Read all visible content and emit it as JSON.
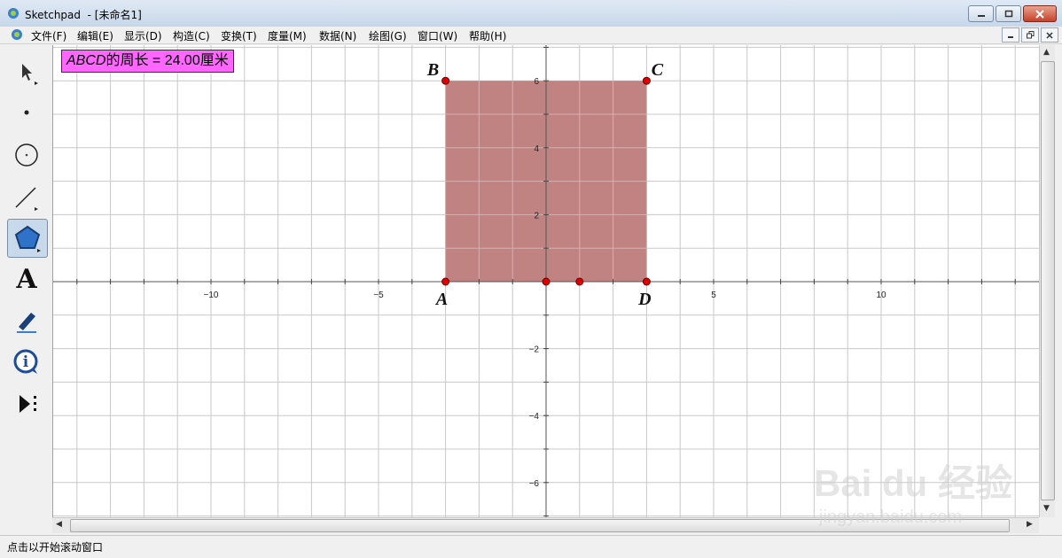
{
  "window": {
    "title": "Sketchpad  - [未命名1]",
    "controls": {
      "minimize": "minimize",
      "restore": "restore",
      "close": "close"
    }
  },
  "menu": [
    {
      "label": "文件(F)"
    },
    {
      "label": "编辑(E)"
    },
    {
      "label": "显示(D)"
    },
    {
      "label": "构造(C)"
    },
    {
      "label": "变换(T)"
    },
    {
      "label": "度量(M)"
    },
    {
      "label": "数据(N)"
    },
    {
      "label": "绘图(G)"
    },
    {
      "label": "窗口(W)"
    },
    {
      "label": "帮助(H)"
    }
  ],
  "toolbox": [
    {
      "name": "arrow-tool",
      "icon": "arrow-select-icon"
    },
    {
      "name": "point-tool",
      "icon": "point-icon"
    },
    {
      "name": "compass-tool",
      "icon": "circle-icon"
    },
    {
      "name": "straightedge-tool",
      "icon": "segment-icon"
    },
    {
      "name": "polygon-tool",
      "icon": "polygon-icon",
      "active": true
    },
    {
      "name": "text-tool",
      "icon": "text-A-icon",
      "glyph": "A"
    },
    {
      "name": "marker-tool",
      "icon": "marker-pen-icon"
    },
    {
      "name": "information-tool",
      "icon": "info-icon",
      "glyph": "i"
    },
    {
      "name": "custom-tool",
      "icon": "custom-tool-icon"
    }
  ],
  "measurement": {
    "name_italic": "ABCD",
    "text": "的周长 = 24.00厘米"
  },
  "graph": {
    "x_ticks": [
      -10,
      -5,
      5,
      10
    ],
    "y_ticks": [
      6,
      4,
      2,
      -2,
      -4,
      -6
    ],
    "x_tick_labels": [
      "−10",
      "−5",
      "5",
      "10"
    ],
    "y_tick_labels": [
      "6",
      "4",
      "2",
      "−2",
      "−4",
      "−6"
    ],
    "polygon": {
      "fill": "#c08080",
      "vertices": [
        {
          "label": "A",
          "x": -3,
          "y": 0
        },
        {
          "label": "B",
          "x": -3,
          "y": 6
        },
        {
          "label": "C",
          "x": 3,
          "y": 6
        },
        {
          "label": "D",
          "x": 3,
          "y": 0
        }
      ]
    },
    "extra_points": [
      {
        "x": 0,
        "y": 0
      },
      {
        "x": 1,
        "y": 0
      }
    ],
    "point_color": "#e00000"
  },
  "status": {
    "text": "点击以开始滚动窗口"
  },
  "watermark": {
    "text": "Bai du 经验",
    "subtext": "jingyan.baidu.com"
  }
}
